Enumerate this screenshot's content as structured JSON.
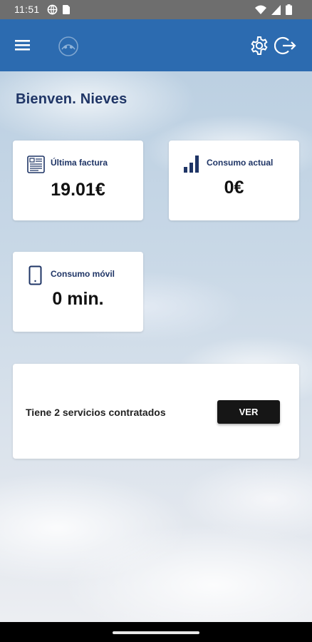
{
  "status_bar": {
    "time": "11:51",
    "icons": [
      "vpn-icon",
      "sim-card-icon",
      "wifi-icon",
      "signal-icon",
      "battery-icon"
    ]
  },
  "app_bar": {
    "menu_icon": "hamburger-menu-icon",
    "logo_icon": "app-logo-icon",
    "settings_icon": "gear-icon",
    "logout_icon": "logout-icon",
    "background": "#2c6bb0"
  },
  "welcome": "Bienven. Nieves",
  "cards": {
    "ultima_factura": {
      "label": "Última factura",
      "value": "19.01€",
      "icon": "invoice-icon"
    },
    "consumo_actual": {
      "label": "Consumo actual",
      "value": "0€",
      "icon": "signal-bars-icon"
    },
    "consumo_movil": {
      "label": "Consumo móvil",
      "value": "0 min.",
      "icon": "mobile-phone-icon"
    }
  },
  "services": {
    "text": "Tiene 2 servicios contratados",
    "button_label": "VER"
  },
  "colors": {
    "accent": "#2c6bb0",
    "heading": "#1f3566",
    "button": "#161616"
  }
}
